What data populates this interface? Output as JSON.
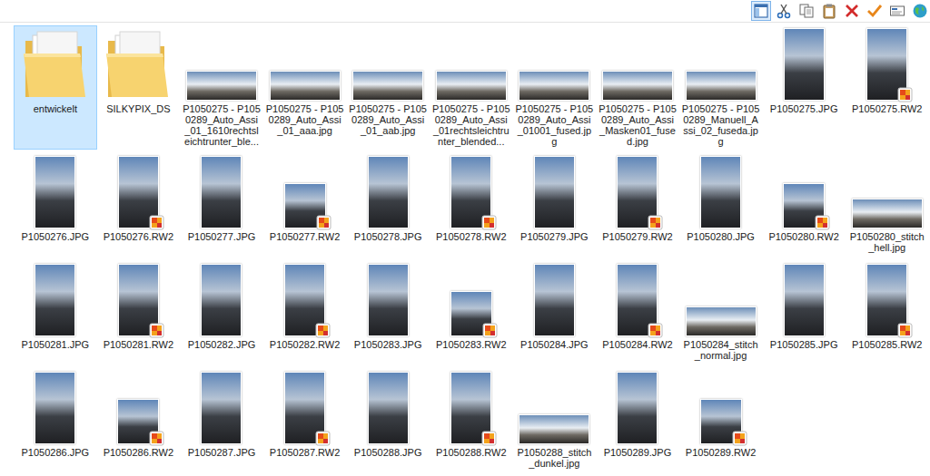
{
  "toolbar": {
    "buttons": [
      {
        "kind": "pane",
        "selected": true
      },
      {
        "kind": "cut",
        "selected": false
      },
      {
        "kind": "copy",
        "selected": false
      },
      {
        "kind": "paste",
        "selected": false
      },
      {
        "kind": "delete",
        "selected": false
      },
      {
        "kind": "check",
        "selected": false
      },
      {
        "kind": "rename",
        "selected": false
      },
      {
        "kind": "globe",
        "selected": false
      }
    ]
  },
  "items": [
    {
      "label": "entwickelt",
      "kind": "folder",
      "orientation": "portrait",
      "selected": true
    },
    {
      "label": "SILKYPIX_DS",
      "kind": "folder",
      "orientation": "portrait",
      "selected": false
    },
    {
      "label": "P1050275 - P1050289_Auto_Assi_01_1610rechtsleichtrunter_ble...",
      "kind": "photo",
      "orientation": "landscape",
      "selected": false
    },
    {
      "label": "P1050275 - P1050289_Auto_Assi_01_aaa.jpg",
      "kind": "photo",
      "orientation": "landscape",
      "selected": false
    },
    {
      "label": "P1050275 - P1050289_Auto_Assi_01_aab.jpg",
      "kind": "photo",
      "orientation": "landscape",
      "selected": false
    },
    {
      "label": "P1050275 - P1050289_Auto_Assi_01rechtsleichtrunter_blended...",
      "kind": "photo",
      "orientation": "landscape",
      "selected": false
    },
    {
      "label": "P1050275 - P1050289_Auto_Assi_01001_fused.jpg",
      "kind": "photo",
      "orientation": "landscape",
      "selected": false
    },
    {
      "label": "P1050275 - P1050289_Auto_Assi_Masken01_fused.jpg",
      "kind": "photo",
      "orientation": "landscape",
      "selected": false
    },
    {
      "label": "P1050275 - P1050289_Manuell_Assi_02_fuseda.jpg",
      "kind": "photo",
      "orientation": "landscape",
      "selected": false
    },
    {
      "label": "P1050275.JPG",
      "kind": "photo",
      "orientation": "portrait",
      "selected": false
    },
    {
      "label": "P1050275.RW2",
      "kind": "raw",
      "orientation": "portrait",
      "selected": false
    },
    {
      "label": "P1050276.JPG",
      "kind": "photo",
      "orientation": "portrait",
      "selected": false
    },
    {
      "label": "P1050276.RW2",
      "kind": "raw",
      "orientation": "portrait",
      "selected": false
    },
    {
      "label": "P1050277.JPG",
      "kind": "photo",
      "orientation": "portrait",
      "selected": false
    },
    {
      "label": "P1050277.RW2",
      "kind": "raw",
      "orientation": "square",
      "selected": false
    },
    {
      "label": "P1050278.JPG",
      "kind": "photo",
      "orientation": "portrait",
      "selected": false
    },
    {
      "label": "P1050278.RW2",
      "kind": "raw",
      "orientation": "portrait",
      "selected": false
    },
    {
      "label": "P1050279.JPG",
      "kind": "photo",
      "orientation": "portrait",
      "selected": false
    },
    {
      "label": "P1050279.RW2",
      "kind": "raw",
      "orientation": "portrait",
      "selected": false
    },
    {
      "label": "P1050280.JPG",
      "kind": "photo",
      "orientation": "portrait",
      "selected": false
    },
    {
      "label": "P1050280.RW2",
      "kind": "raw",
      "orientation": "square",
      "selected": false
    },
    {
      "label": "P1050280_stitch_hell.jpg",
      "kind": "photo",
      "orientation": "landscape",
      "selected": false
    },
    {
      "label": "P1050281.JPG",
      "kind": "photo",
      "orientation": "portrait",
      "selected": false
    },
    {
      "label": "P1050281.RW2",
      "kind": "raw",
      "orientation": "portrait",
      "selected": false
    },
    {
      "label": "P1050282.JPG",
      "kind": "photo",
      "orientation": "portrait",
      "selected": false
    },
    {
      "label": "P1050282.RW2",
      "kind": "raw",
      "orientation": "portrait",
      "selected": false
    },
    {
      "label": "P1050283.JPG",
      "kind": "photo",
      "orientation": "portrait",
      "selected": false
    },
    {
      "label": "P1050283.RW2",
      "kind": "raw",
      "orientation": "square",
      "selected": false
    },
    {
      "label": "P1050284.JPG",
      "kind": "photo",
      "orientation": "portrait",
      "selected": false
    },
    {
      "label": "P1050284.RW2",
      "kind": "raw",
      "orientation": "portrait",
      "selected": false
    },
    {
      "label": "P1050284_stitch_normal.jpg",
      "kind": "photo",
      "orientation": "landscape",
      "selected": false
    },
    {
      "label": "P1050285.JPG",
      "kind": "photo",
      "orientation": "portrait",
      "selected": false
    },
    {
      "label": "P1050285.RW2",
      "kind": "raw",
      "orientation": "portrait",
      "selected": false
    },
    {
      "label": "P1050286.JPG",
      "kind": "photo",
      "orientation": "portrait",
      "selected": false
    },
    {
      "label": "P1050286.RW2",
      "kind": "raw",
      "orientation": "square",
      "selected": false
    },
    {
      "label": "P1050287.JPG",
      "kind": "photo",
      "orientation": "portrait",
      "selected": false
    },
    {
      "label": "P1050287.RW2",
      "kind": "raw",
      "orientation": "portrait",
      "selected": false
    },
    {
      "label": "P1050288.JPG",
      "kind": "photo",
      "orientation": "portrait",
      "selected": false
    },
    {
      "label": "P1050288.RW2",
      "kind": "raw",
      "orientation": "portrait",
      "selected": false
    },
    {
      "label": "P1050288_stitch_dunkel.jpg",
      "kind": "photo",
      "orientation": "landscape",
      "selected": false
    },
    {
      "label": "P1050289.JPG",
      "kind": "photo",
      "orientation": "portrait",
      "selected": false
    },
    {
      "label": "P1050289.RW2",
      "kind": "raw",
      "orientation": "square",
      "selected": false
    }
  ]
}
